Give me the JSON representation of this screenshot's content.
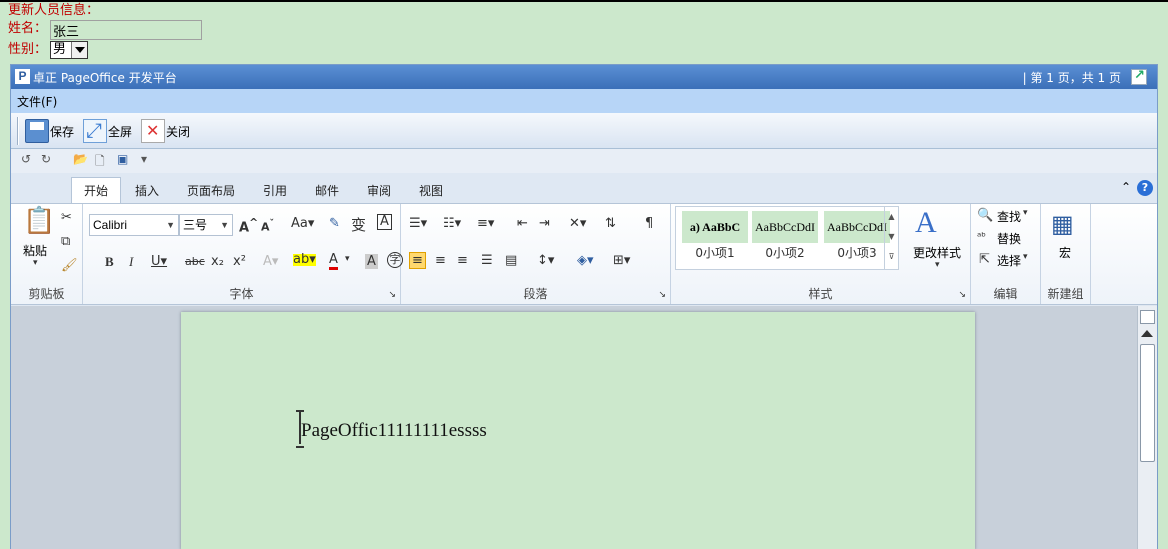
{
  "form": {
    "heading": "更新人员信息：",
    "name_label": "姓名：",
    "name_value": "张三",
    "sex_label": "性别：",
    "sex_value": "男"
  },
  "pageoffice": {
    "logo": "P",
    "title": "卓正 PageOffice 开发平台",
    "page_info": "| 第 1 页，共 1 页",
    "menu": {
      "file": "文件(F)"
    },
    "toolbar": {
      "save": "保存",
      "fullscreen": "全屏",
      "close": "关闭"
    }
  },
  "word": {
    "tabs": [
      "开始",
      "插入",
      "页面布局",
      "引用",
      "邮件",
      "审阅",
      "视图"
    ],
    "active_tab": "开始",
    "ribbon": {
      "clipboard": {
        "paste": "粘贴",
        "group": "剪贴板"
      },
      "font": {
        "name": "Calibri",
        "size": "三号",
        "group": "字体"
      },
      "paragraph": {
        "group": "段落"
      },
      "styles": {
        "items": [
          {
            "sample": "a) AaBbC",
            "name": "0小项1"
          },
          {
            "sample": "AaBbCcDdI",
            "name": "0小项2"
          },
          {
            "sample": "AaBbCcDdI",
            "name": "0小项3"
          }
        ],
        "change_styles": "更改样式",
        "group": "样式"
      },
      "editing": {
        "find": "查找",
        "replace": "替换",
        "select": "选择",
        "group": "编辑"
      },
      "macro": {
        "label": "宏",
        "group": "新建组"
      }
    },
    "document": {
      "text": "PageOffic11111111essss"
    }
  },
  "colors": {
    "background": "#cce8cc",
    "form_label": "#c00000",
    "titlebar": "#4a80c8"
  }
}
